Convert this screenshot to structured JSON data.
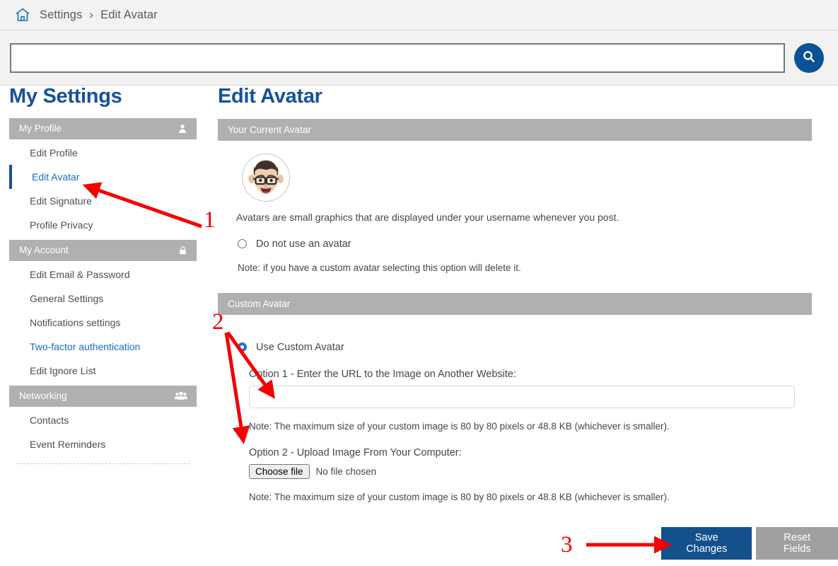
{
  "breadcrumb": {
    "home_icon": "home-icon",
    "items": [
      "Settings",
      "Edit Avatar"
    ],
    "separator": "›"
  },
  "search": {
    "value": "",
    "placeholder": "",
    "button_icon": "search-icon"
  },
  "sidebar": {
    "title": "My Settings",
    "groups": [
      {
        "label": "My Profile",
        "icon": "user-icon",
        "items": [
          {
            "label": "Edit Profile",
            "state": "default"
          },
          {
            "label": "Edit Avatar",
            "state": "active"
          },
          {
            "label": "Edit Signature",
            "state": "default"
          },
          {
            "label": "Profile Privacy",
            "state": "default"
          }
        ]
      },
      {
        "label": "My Account",
        "icon": "lock-icon",
        "items": [
          {
            "label": "Edit Email & Password",
            "state": "default"
          },
          {
            "label": "General Settings",
            "state": "default"
          },
          {
            "label": "Notifications settings",
            "state": "default"
          },
          {
            "label": "Two-factor authentication",
            "state": "link"
          },
          {
            "label": "Edit Ignore List",
            "state": "default"
          }
        ]
      },
      {
        "label": "Networking",
        "icon": "people-group-icon",
        "items": [
          {
            "label": "Contacts",
            "state": "default"
          },
          {
            "label": "Event Reminders",
            "state": "default"
          }
        ]
      }
    ]
  },
  "main": {
    "title": "Edit Avatar",
    "current_avatar": {
      "panel_title": "Your Current Avatar",
      "avatar_alt": "memoji-avatar",
      "description": "Avatars are small graphics that are displayed under your username whenever you post.",
      "no_avatar_option": {
        "label": "Do not use an avatar",
        "checked": false
      },
      "note": "Note: if you have a custom avatar selecting this option will delete it."
    },
    "custom_avatar": {
      "panel_title": "Custom Avatar",
      "use_custom_option": {
        "label": "Use Custom Avatar",
        "checked": true
      },
      "option1_label": "Option 1 - Enter the URL to the Image on Another Website:",
      "url_value": "",
      "url_placeholder": "",
      "option1_note": "Note: The maximum size of your custom image is 80 by 80 pixels or 48.8 KB (whichever is smaller).",
      "option2_label": "Option 2 - Upload Image From Your Computer:",
      "choose_file_label": "Choose file",
      "file_status": "No file chosen",
      "option2_note": "Note: The maximum size of your custom image is 80 by 80 pixels or 48.8 KB (whichever is smaller)."
    },
    "actions": {
      "save_label": "Save Changes",
      "reset_label": "Reset Fields"
    }
  },
  "annotations": {
    "color": "#f40000",
    "markers": [
      {
        "number": "1",
        "target": "sidebar-item-edit-avatar"
      },
      {
        "number": "2",
        "target": "custom-avatar-inputs"
      },
      {
        "number": "3",
        "target": "save-changes-button"
      }
    ]
  },
  "colors": {
    "brand_blue": "#15519b",
    "link_blue": "#1b6cc4",
    "panel_gray": "#b0b0b0",
    "primary_button": "#14508c",
    "secondary_button": "#a0a0a0",
    "annotation_red": "#f40000",
    "chrome_gray": "#f2f2f2"
  }
}
